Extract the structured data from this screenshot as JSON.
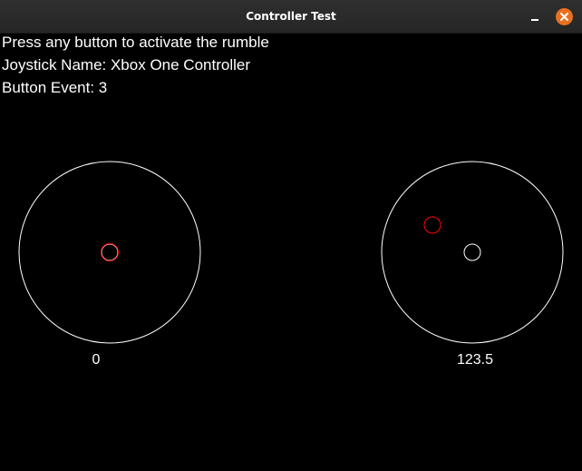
{
  "window": {
    "title": "Controller Test"
  },
  "info": {
    "prompt": "Press any button to activate the rumble",
    "joystick_name": "Joystick Name: Xbox One Controller",
    "button_event": "Button Event: 3"
  },
  "left_stick": {
    "value_label": "0"
  },
  "right_stick": {
    "value_label": "123.5"
  },
  "colors": {
    "background": "#000000",
    "outline": "#ffffff",
    "stick_indicator": "#ff0000",
    "close_button": "#e8701f"
  },
  "icons": {
    "minimize": "minimize-icon",
    "close": "close-icon"
  }
}
